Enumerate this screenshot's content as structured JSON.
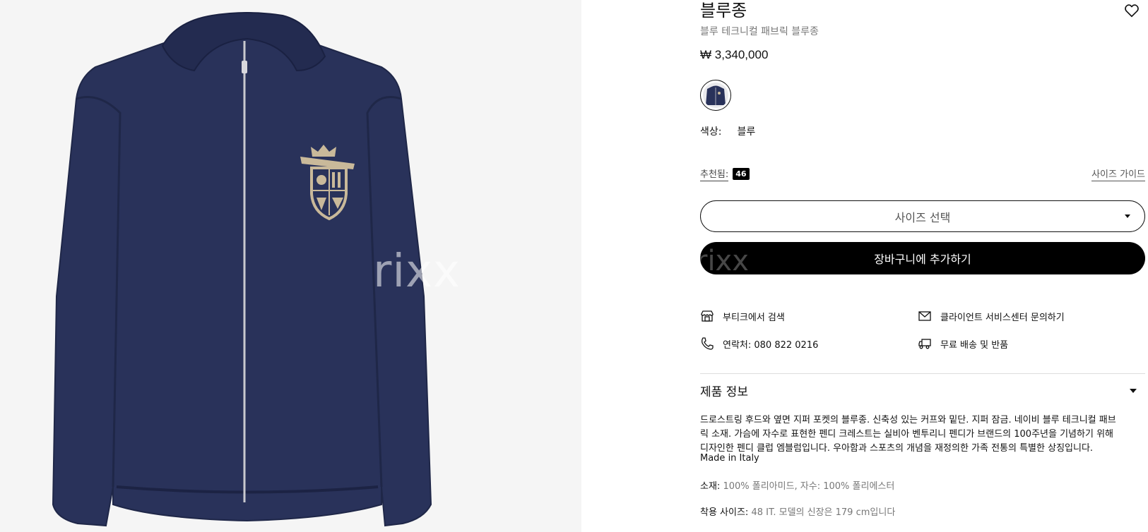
{
  "product": {
    "title": "블루종",
    "subtitle": "블루 테크니컬 패브릭 블루종",
    "price": "₩ 3,340,000",
    "color_label": "색상:",
    "color_value": "블루"
  },
  "image": {
    "watermark": "rixx",
    "jacket_color": "#29325a",
    "jacket_shadow": "#1f2748",
    "crest_color": "#c9b99a"
  },
  "size": {
    "recommended_label": "추천됨:",
    "recommended_value": "46",
    "size_guide_label": "사이즈 가이드",
    "select_label": "사이즈 선택"
  },
  "cart": {
    "add_label": "장바구니에 추가하기",
    "watermark": "rixx"
  },
  "services": [
    {
      "icon": "store-icon",
      "label": "부티크에서 검색"
    },
    {
      "icon": "mail-icon",
      "label": "클라이언트 서비스센터 문의하기"
    },
    {
      "icon": "phone-icon",
      "label": "연락처: 080 822 0216"
    },
    {
      "icon": "truck-icon",
      "label": "무료 배송 및 반품"
    }
  ],
  "info": {
    "title": "제품 정보",
    "description_lines": [
      "드로스트링 후드와 옆면 지퍼 포켓의 블루종. 신축성 있는 커프와 밑단. 지퍼 잠금. 네이비 블루 테크니컬 패브",
      "릭 소재. 가슴에 자수로 표현한 펜디 크레스트는 실비아 벤투리니 펜디가 브랜드의 100주년을 기념하기 위해",
      "디자인한 펜디 클럽 엠블럼입니다. 우아함과 스포츠의 개념을 재정의한 가족 전통의 특별한 상징입니다."
    ],
    "made_in": "Made in Italy",
    "material_label": "소재:",
    "material_value": " 100% 폴리아미드, 자수: 100% 폴리에스터",
    "fit_label": "착용 사이즈:",
    "fit_value": " 48 IT. 모델의 신장은 179 cm입니다"
  }
}
